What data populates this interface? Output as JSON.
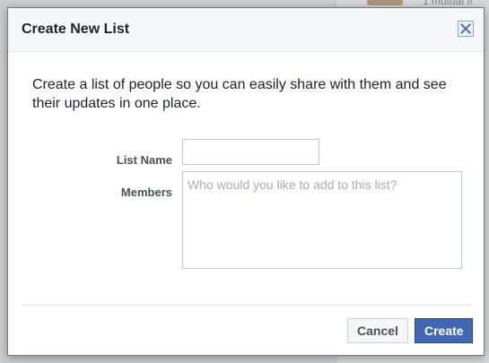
{
  "background": {
    "snippet_text": "1 mutual fr"
  },
  "dialog": {
    "title": "Create New List",
    "close_icon": "close-icon",
    "intro_text": "Create a list of people so you can easily share with them and see their updates in one place.",
    "fields": {
      "list_name": {
        "label": "List Name",
        "value": "",
        "placeholder": ""
      },
      "members": {
        "label": "Members",
        "value": "",
        "placeholder": "Who would you like to add to this list?"
      }
    },
    "buttons": {
      "cancel_label": "Cancel",
      "create_label": "Create"
    }
  },
  "colors": {
    "primary_button": "#4267b2",
    "header_background": "#f6f7f9",
    "close_icon": "#4e6fb5"
  }
}
